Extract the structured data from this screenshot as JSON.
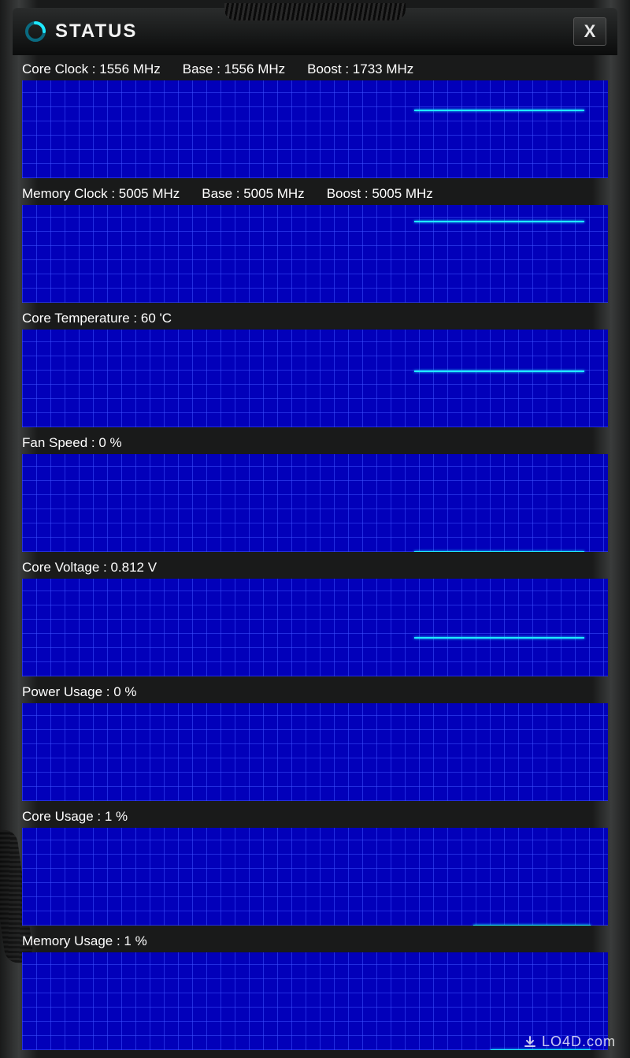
{
  "header": {
    "title": "STATUS",
    "close_label": "X"
  },
  "metrics": [
    {
      "label_parts": [
        "Core Clock : 1556 MHz",
        "Base : 1556 MHz",
        "Boost : 1733 MHz"
      ],
      "trace": {
        "start_pct": 67,
        "end_pct": 96,
        "y_pct": 30
      }
    },
    {
      "label_parts": [
        "Memory Clock : 5005 MHz",
        "Base : 5005 MHz",
        "Boost : 5005 MHz"
      ],
      "trace": {
        "start_pct": 67,
        "end_pct": 96,
        "y_pct": 16
      }
    },
    {
      "label_parts": [
        "Core Temperature : 60 'C"
      ],
      "trace": {
        "start_pct": 67,
        "end_pct": 96,
        "y_pct": 42
      }
    },
    {
      "label_parts": [
        "Fan Speed : 0 %"
      ],
      "trace": {
        "start_pct": 67,
        "end_pct": 96,
        "y_pct": 99
      }
    },
    {
      "label_parts": [
        "Core Voltage : 0.812 V"
      ],
      "trace": {
        "start_pct": 67,
        "end_pct": 96,
        "y_pct": 60
      }
    },
    {
      "label_parts": [
        "Power Usage : 0 %"
      ],
      "trace": null
    },
    {
      "label_parts": [
        "Core Usage : 1 %"
      ],
      "trace": {
        "start_pct": 77,
        "end_pct": 97,
        "y_pct": 99
      }
    },
    {
      "label_parts": [
        "Memory Usage : 1 %"
      ],
      "trace": {
        "start_pct": 80,
        "end_pct": 97,
        "y_pct": 99
      }
    }
  ],
  "watermark": "LO4D.com",
  "chart_data": [
    {
      "type": "line",
      "title": "Core Clock",
      "unit": "MHz",
      "current": 1556,
      "base": 1556,
      "boost": 1733,
      "ylim": [
        0,
        2000
      ],
      "series": [
        {
          "name": "Core Clock",
          "values": [
            1733
          ]
        }
      ]
    },
    {
      "type": "line",
      "title": "Memory Clock",
      "unit": "MHz",
      "current": 5005,
      "base": 5005,
      "boost": 5005,
      "ylim": [
        0,
        6000
      ],
      "series": [
        {
          "name": "Memory Clock",
          "values": [
            5005
          ]
        }
      ]
    },
    {
      "type": "line",
      "title": "Core Temperature",
      "unit": "°C",
      "current": 60,
      "ylim": [
        0,
        100
      ],
      "series": [
        {
          "name": "Core Temperature",
          "values": [
            60
          ]
        }
      ]
    },
    {
      "type": "line",
      "title": "Fan Speed",
      "unit": "%",
      "current": 0,
      "ylim": [
        0,
        100
      ],
      "series": [
        {
          "name": "Fan Speed",
          "values": [
            0
          ]
        }
      ]
    },
    {
      "type": "line",
      "title": "Core Voltage",
      "unit": "V",
      "current": 0.812,
      "ylim": [
        0,
        2
      ],
      "series": [
        {
          "name": "Core Voltage",
          "values": [
            0.812
          ]
        }
      ]
    },
    {
      "type": "line",
      "title": "Power Usage",
      "unit": "%",
      "current": 0,
      "ylim": [
        0,
        100
      ],
      "series": [
        {
          "name": "Power Usage",
          "values": [
            0
          ]
        }
      ]
    },
    {
      "type": "line",
      "title": "Core Usage",
      "unit": "%",
      "current": 1,
      "ylim": [
        0,
        100
      ],
      "series": [
        {
          "name": "Core Usage",
          "values": [
            1
          ]
        }
      ]
    },
    {
      "type": "line",
      "title": "Memory Usage",
      "unit": "%",
      "current": 1,
      "ylim": [
        0,
        100
      ],
      "series": [
        {
          "name": "Memory Usage",
          "values": [
            1
          ]
        }
      ]
    }
  ]
}
